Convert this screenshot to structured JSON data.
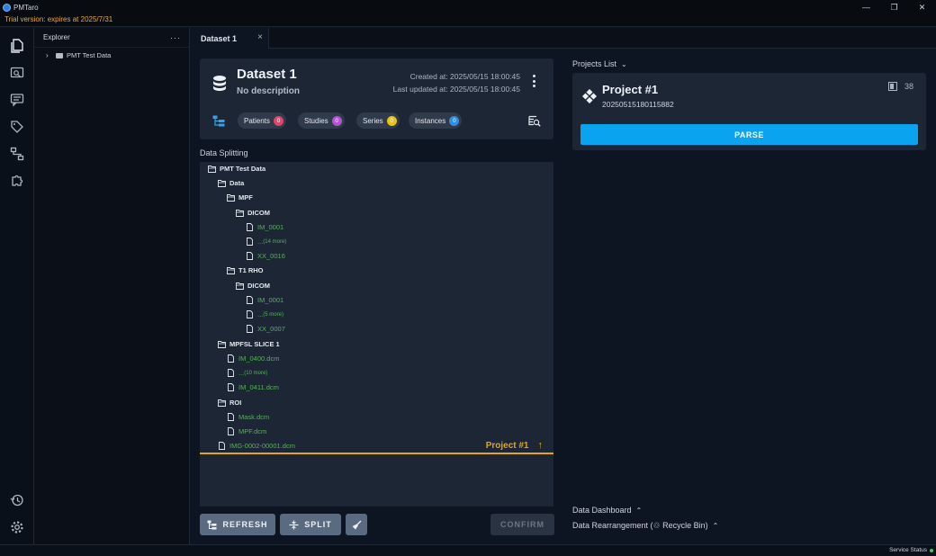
{
  "window": {
    "title": "PMTaro",
    "controls": {
      "minimize": "—",
      "maximize": "❐",
      "close": "✕"
    }
  },
  "trial_banner": "Trial version: expires at 2025/7/31",
  "activity_rail": {
    "icons": [
      "files-icon",
      "image-search-icon",
      "chat-icon",
      "tag-icon",
      "flow-icon",
      "puzzle-icon",
      "history-icon",
      "gear-icon"
    ]
  },
  "explorer": {
    "title": "Explorer",
    "more": "···",
    "items": [
      {
        "label": "PMT Test Data"
      }
    ]
  },
  "tabs": [
    {
      "label": "Dataset 1",
      "close": "×"
    }
  ],
  "dataset": {
    "title": "Dataset 1",
    "description": "No description",
    "created": "Created at: 2025/05/15 18:00:45",
    "updated": "Last updated at: 2025/05/15 18:00:45",
    "chips": [
      {
        "label": "Patients",
        "count": "0",
        "color": "#e0456f"
      },
      {
        "label": "Studies",
        "count": "0",
        "color": "#b452d6"
      },
      {
        "label": "Series",
        "count": "0",
        "color": "#e8c21b"
      },
      {
        "label": "Instances",
        "count": "0",
        "color": "#2f8fe8"
      }
    ]
  },
  "data_splitting": {
    "label": "Data Splitting",
    "tree": [
      {
        "type": "folder",
        "label": "PMT Test Data"
      },
      {
        "type": "folder",
        "label": "Data"
      },
      {
        "type": "folder",
        "label": "MPF"
      },
      {
        "type": "folder",
        "label": "DICOM"
      },
      {
        "type": "file",
        "label": "IM_0001"
      },
      {
        "type": "more",
        "label": "... ",
        "note": "(14 more)"
      },
      {
        "type": "file",
        "label": "XX_0016"
      },
      {
        "type": "folder",
        "label": "T1 RHO"
      },
      {
        "type": "folder",
        "label": "DICOM"
      },
      {
        "type": "file",
        "label": "IM_0001"
      },
      {
        "type": "more",
        "label": "... ",
        "note": "(5 more)"
      },
      {
        "type": "file",
        "label": "XX_0007"
      },
      {
        "type": "folder",
        "label": "MPFSL SLICE 1"
      },
      {
        "type": "file",
        "label": "IM_0400.dcm"
      },
      {
        "type": "more",
        "label": "... ",
        "note": "(10 more)"
      },
      {
        "type": "file",
        "label": "IM_0411.dcm"
      },
      {
        "type": "folder",
        "label": "ROI"
      },
      {
        "type": "file",
        "label": "Mask.dcm"
      },
      {
        "type": "file",
        "label": "MPF.dcm"
      },
      {
        "type": "file",
        "label": "IMG-0002-00001.dcm"
      }
    ],
    "split_marker": {
      "label": "Project #1",
      "arrow": "↑"
    }
  },
  "actions": {
    "refresh": "REFRESH",
    "split": "SPLIT",
    "confirm": "CONFIRM"
  },
  "projects": {
    "label": "Projects List",
    "items": [
      {
        "title": "Project #1",
        "id": "20250515180115882",
        "count": "38",
        "action": "PARSE"
      }
    ]
  },
  "footer_links": {
    "dashboard": "Data Dashboard",
    "rearrangement": "Data Rearrangement (♲ Recycle Bin)"
  },
  "status_bar": {
    "text": "Service Status",
    "status_color": "#3ecf5a"
  }
}
